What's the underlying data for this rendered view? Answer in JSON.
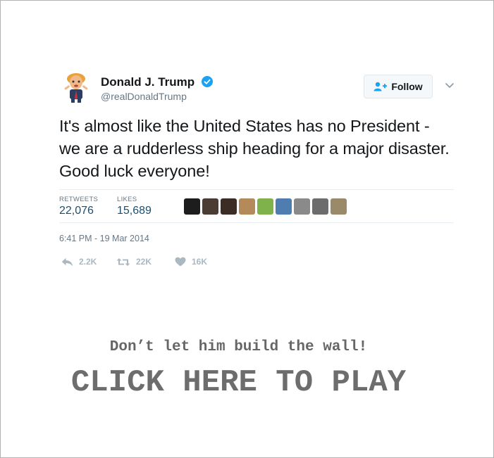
{
  "tweet": {
    "author_name": "Donald J. Trump",
    "handle": "@realDonaldTrump",
    "text": "It's almost like the United States has no President - we are a rudderless ship heading for a major disaster. Good luck everyone!",
    "follow_label": "Follow",
    "stats": {
      "retweets_label": "RETWEETS",
      "retweets_value": "22,076",
      "likes_label": "LIKES",
      "likes_value": "15,689"
    },
    "liker_avatars": [
      "#1d1d1d",
      "#4a3b33",
      "#3b2c26",
      "#b58a5a",
      "#7fb24a",
      "#4f7db0",
      "#8a8a8a",
      "#6c6c6c",
      "#9a8a6a"
    ],
    "timestamp": "6:41 PM - 19 Mar 2014",
    "actions": {
      "reply_count": "2.2K",
      "retweet_count": "22K",
      "like_count": "16K"
    }
  },
  "cta": {
    "subtitle": "Don’t let him build the wall!",
    "button": "CLICK HERE TO PLAY"
  },
  "colors": {
    "verified_blue": "#1da1f2",
    "follow_icon_blue": "#1da1f2",
    "stat_value": "#1b4f72",
    "muted_text": "#657786",
    "action_grey": "#aab8c2"
  }
}
